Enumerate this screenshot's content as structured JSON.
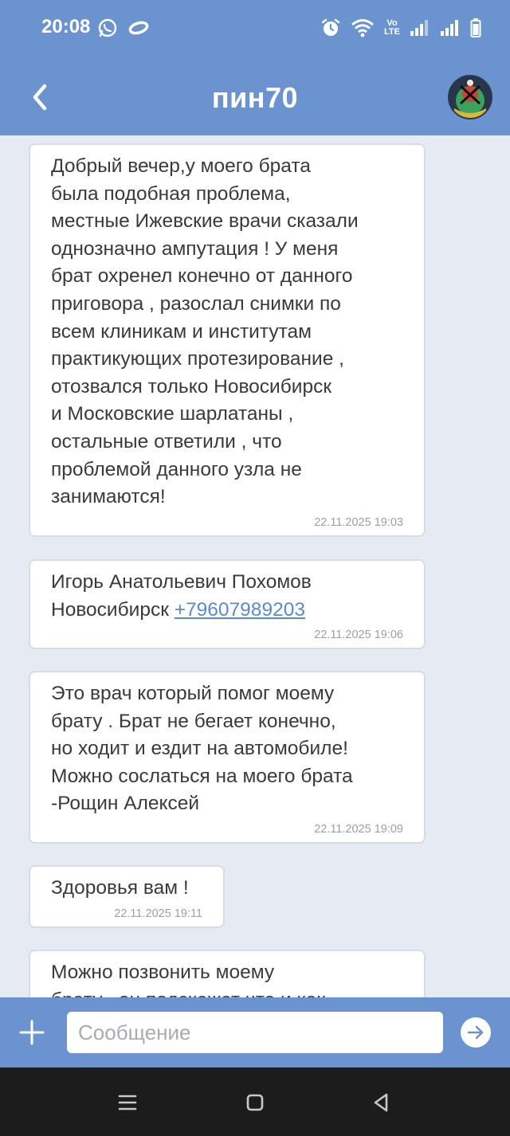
{
  "status_bar": {
    "time": "20:08",
    "left_icons": [
      "whatsapp-icon",
      "chat-o-icon"
    ],
    "right_icons": [
      "alarm-icon",
      "wifi-icon",
      "volte-icon",
      "signal-icon",
      "signal-icon",
      "battery-icon"
    ],
    "volte_label_top": "Vo",
    "volte_label_bottom": "LTE"
  },
  "header": {
    "title": "пин70",
    "back_icon": "chevron-left-icon",
    "avatar_icon": "avatar"
  },
  "messages": [
    {
      "text": "Добрый вечер,у моего брата\nбыла подобная проблема,\nместные Ижевские врачи сказали\nоднозначно ампутация ! У меня\nбрат охренел конечно от данного\nприговора , разослал снимки по\nвсем клиникам и институтам\nпрактикующих протезирование ,\nотозвался только Новосибирск\nи Московские шарлатаны ,\nостальные ответили , что\nпроблемой данного узла не\nзанимаются!",
      "time": "22.11.2025 19:03"
    },
    {
      "text": "Игорь Анатольевич Похомов\nНовосибирск ",
      "link": "+79607989203",
      "time": "22.11.2025 19:06"
    },
    {
      "text": "Это врач который помог моему\nбрату . Брат не бегает конечно,\nно ходит и ездит на автомобиле!\nМожно сослаться на моего брата\n-Рощин Алексей",
      "time": "22.11.2025 19:09"
    },
    {
      "text": "Здоровья вам !",
      "time": "22.11.2025 19:11"
    },
    {
      "text": "Можно позвонить моему\nбрату , он подскажет что и как",
      "time": ""
    }
  ],
  "composer": {
    "placeholder": "Сообщение",
    "add_icon": "plus-icon",
    "send_icon": "send-arrow-icon"
  },
  "navigation": {
    "buttons": [
      "menu-icon",
      "home-square-icon",
      "back-triangle-icon"
    ]
  },
  "colors": {
    "accent": "#6b93d0",
    "background": "#e6ebf3",
    "bubble": "#ffffff",
    "link": "#5a8ad0",
    "navbar": "#1c1c1c"
  }
}
